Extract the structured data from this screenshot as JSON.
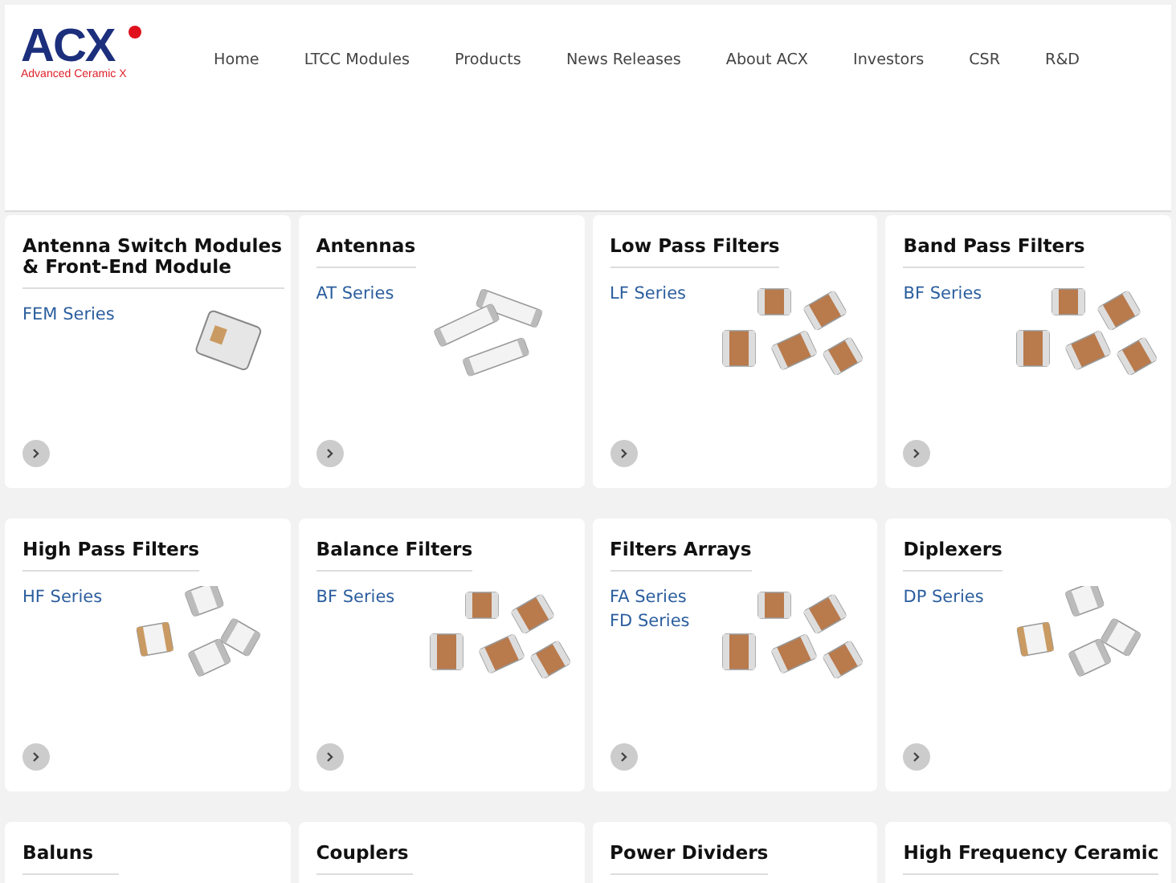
{
  "logo": {
    "mark": "ACX",
    "tagline": "Advanced Ceramic X"
  },
  "nav": [
    {
      "label": "Home"
    },
    {
      "label": "LTCC Modules"
    },
    {
      "label": "Products"
    },
    {
      "label": "News Releases"
    },
    {
      "label": "About ACX"
    },
    {
      "label": "Investors"
    },
    {
      "label": "CSR"
    },
    {
      "label": "R&D"
    }
  ],
  "products": [
    {
      "title": "Antenna Switch Modules & Front-End Module",
      "series": [
        "FEM Series"
      ],
      "kind": "module"
    },
    {
      "title": "Antennas",
      "series": [
        "AT Series"
      ],
      "kind": "bar"
    },
    {
      "title": "Low Pass Filters",
      "series": [
        "LF Series"
      ],
      "kind": "brown"
    },
    {
      "title": "Band Pass Filters",
      "series": [
        "BF Series"
      ],
      "kind": "brown"
    },
    {
      "title": "High Pass Filters",
      "series": [
        "HF Series"
      ],
      "kind": "white"
    },
    {
      "title": "Balance Filters",
      "series": [
        "BF Series"
      ],
      "kind": "brown"
    },
    {
      "title": "Filters Arrays",
      "series": [
        "FA Series",
        "FD Series"
      ],
      "kind": "brown"
    },
    {
      "title": "Diplexers",
      "series": [
        "DP Series"
      ],
      "kind": "white"
    },
    {
      "title": "Baluns",
      "kind": "none"
    },
    {
      "title": "Couplers",
      "kind": "none"
    },
    {
      "title": "Power Dividers",
      "kind": "none"
    },
    {
      "title": "High Frequency Ceramic",
      "kind": "none"
    }
  ]
}
